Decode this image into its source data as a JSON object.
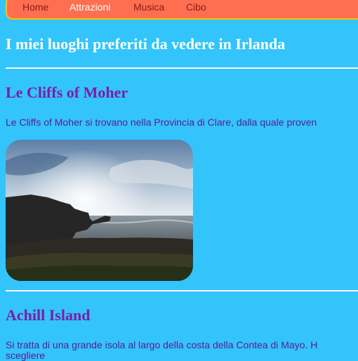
{
  "nav": {
    "items": [
      {
        "label": "Home",
        "active": false
      },
      {
        "label": "Attrazioni",
        "active": true
      },
      {
        "label": "Musica",
        "active": false
      },
      {
        "label": "Cibo",
        "active": false
      }
    ]
  },
  "page_title": "I miei luoghi preferiti da vedere in Irlanda",
  "sections": [
    {
      "title": "Le Cliffs of Moher",
      "text": "Le Cliffs of Moher si trovano nella Provincia di Clare, dalla quale proven"
    },
    {
      "title": "Achill Island",
      "text": "Si tratta di una grande isola al largo della costa della Contea di Mayo. H",
      "text_line2": "scegliere"
    }
  ],
  "colors": {
    "background": "#33c4fb",
    "nav_bg": "#fd6f50",
    "nav_border": "#f5c400",
    "heading": "#7a1fa3",
    "body_text": "#5a1a9e"
  }
}
